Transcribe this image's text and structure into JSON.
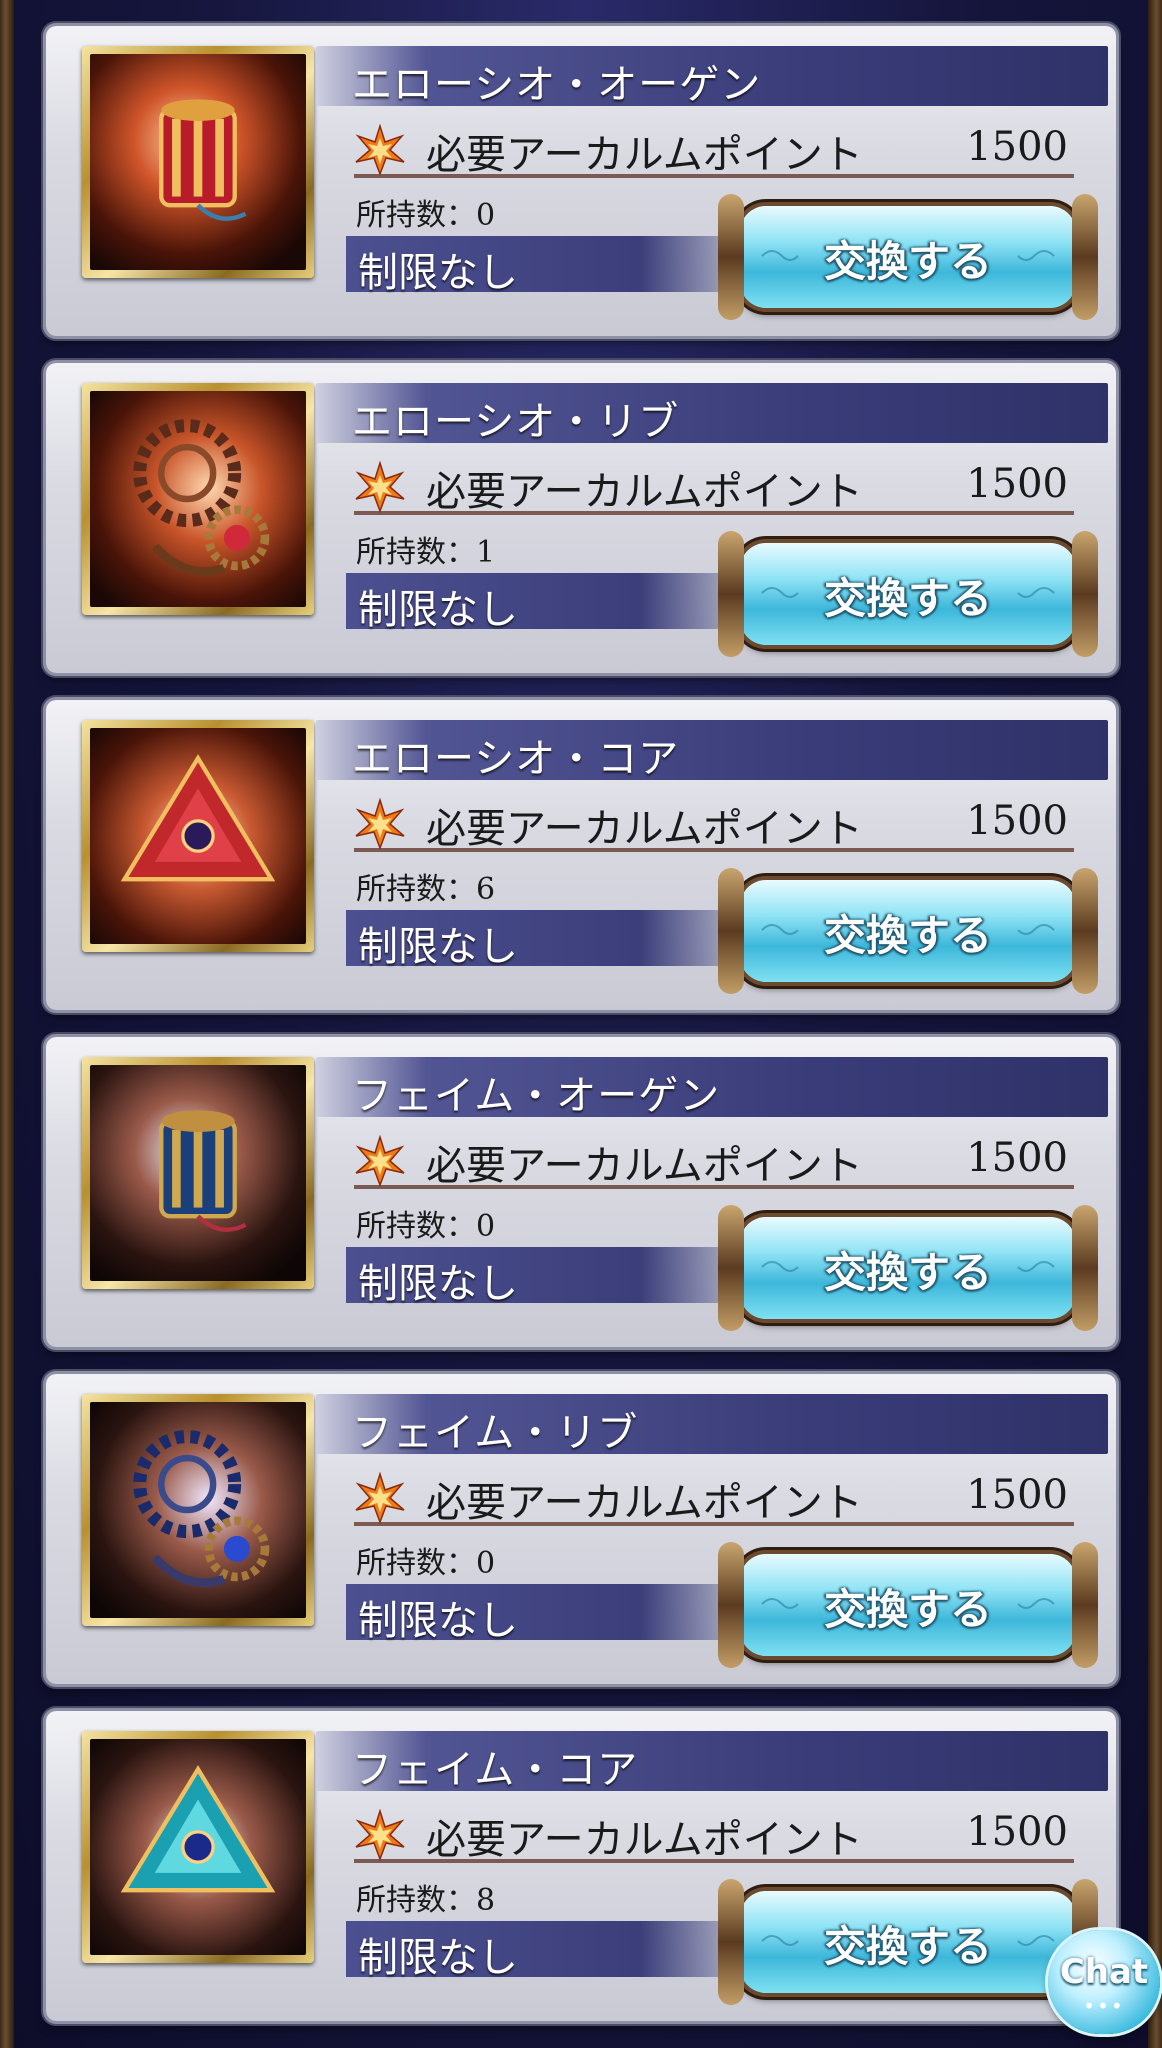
{
  "cost_label": "必要アーカルムポイント",
  "owned_label": "所持数：",
  "items": [
    {
      "name": "エローシオ・オーゲン",
      "cost": "1500",
      "owned": "0",
      "limit": "制限なし",
      "button": "交換する",
      "icon": "red-drum-icon"
    },
    {
      "name": "エローシオ・リブ",
      "cost": "1500",
      "owned": "1",
      "limit": "制限なし",
      "button": "交換する",
      "icon": "red-gear-icon"
    },
    {
      "name": "エローシオ・コア",
      "cost": "1500",
      "owned": "6",
      "limit": "制限なし",
      "button": "交換する",
      "icon": "red-core-icon"
    },
    {
      "name": "フェイム・オーゲン",
      "cost": "1500",
      "owned": "0",
      "limit": "制限なし",
      "button": "交換する",
      "icon": "blue-drum-icon"
    },
    {
      "name": "フェイム・リブ",
      "cost": "1500",
      "owned": "0",
      "limit": "制限なし",
      "button": "交換する",
      "icon": "blue-gear-icon"
    },
    {
      "name": "フェイム・コア",
      "cost": "1500",
      "owned": "8",
      "limit": "制限なし",
      "button": "交換する",
      "icon": "cyan-core-icon"
    }
  ],
  "chat": {
    "label": "Chat",
    "dots": "•••"
  },
  "colors": {
    "name_bar": "#3a3d7a",
    "button": "#3db7da",
    "frame_gold": "#b8902f",
    "red_item": "#c0282b",
    "blue_item": "#2a5fa8"
  }
}
